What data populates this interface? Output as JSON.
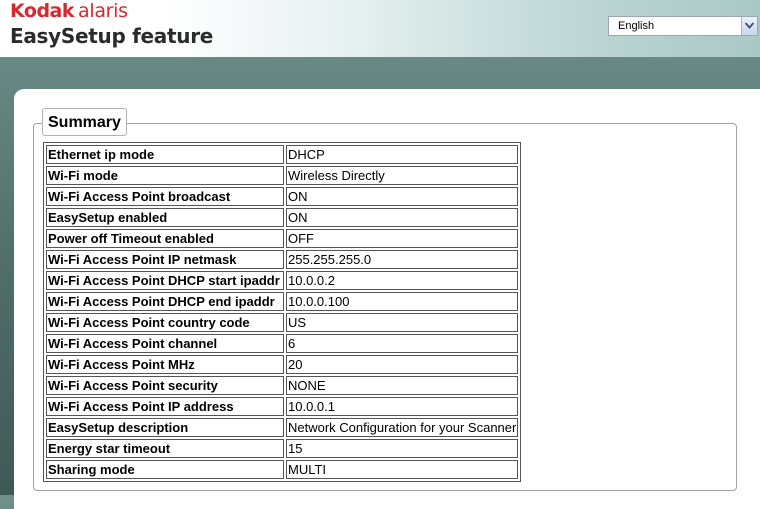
{
  "header": {
    "brand_kodak": "Kodak",
    "brand_alaris": "alaris",
    "app_title": "EasySetup feature"
  },
  "language": {
    "selected": "English"
  },
  "summary": {
    "legend": "Summary",
    "rows": [
      {
        "key": "Ethernet ip mode",
        "value": "DHCP"
      },
      {
        "key": "Wi-Fi mode",
        "value": "Wireless Directly"
      },
      {
        "key": "Wi-Fi Access Point broadcast",
        "value": "ON"
      },
      {
        "key": "EasySetup enabled",
        "value": "ON"
      },
      {
        "key": "Power off Timeout enabled",
        "value": "OFF"
      },
      {
        "key": "Wi-Fi Access Point IP netmask",
        "value": "255.255.255.0"
      },
      {
        "key": "Wi-Fi Access Point DHCP start ipaddr",
        "value": "10.0.0.2"
      },
      {
        "key": "Wi-Fi Access Point DHCP end ipaddr",
        "value": "10.0.0.100"
      },
      {
        "key": "Wi-Fi Access Point country code",
        "value": "US"
      },
      {
        "key": "Wi-Fi Access Point channel",
        "value": "6"
      },
      {
        "key": "Wi-Fi Access Point MHz",
        "value": "20"
      },
      {
        "key": "Wi-Fi Access Point security",
        "value": "NONE"
      },
      {
        "key": "Wi-Fi Access Point IP address",
        "value": "10.0.0.1"
      },
      {
        "key": "EasySetup description",
        "value": "Network Configuration for your Scanner"
      },
      {
        "key": "Energy star timeout",
        "value": "15"
      },
      {
        "key": "Sharing mode",
        "value": "MULTI"
      }
    ]
  },
  "colors": {
    "brand_red": "#d7282f",
    "background_teal": "#4f6e6a"
  },
  "icons": {
    "dropdown": "chevron-down-icon"
  }
}
